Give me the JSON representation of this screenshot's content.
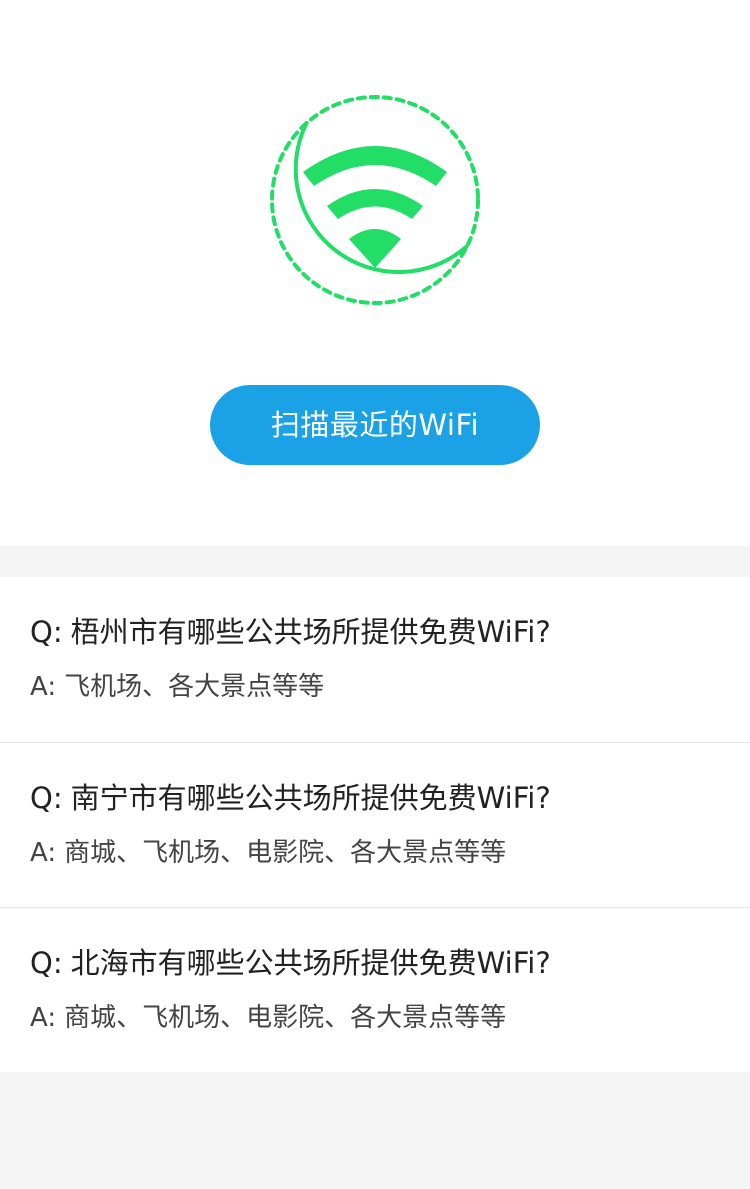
{
  "scan": {
    "button_label": "扫描最近的WiFi"
  },
  "faq": [
    {
      "q_prefix": "Q:",
      "question": "梧州市有哪些公共场所提供免费WiFi?",
      "a_prefix": "A:",
      "answer": "飞机场、各大景点等等"
    },
    {
      "q_prefix": "Q:",
      "question": "南宁市有哪些公共场所提供免费WiFi?",
      "a_prefix": "A:",
      "answer": "商城、飞机场、电影院、各大景点等等"
    },
    {
      "q_prefix": "Q:",
      "question": "北海市有哪些公共场所提供免费WiFi?",
      "a_prefix": "A:",
      "answer": "商城、飞机场、电影院、各大景点等等"
    }
  ],
  "colors": {
    "accent_green": "#22dd66",
    "button_blue": "#1aa1e6"
  }
}
